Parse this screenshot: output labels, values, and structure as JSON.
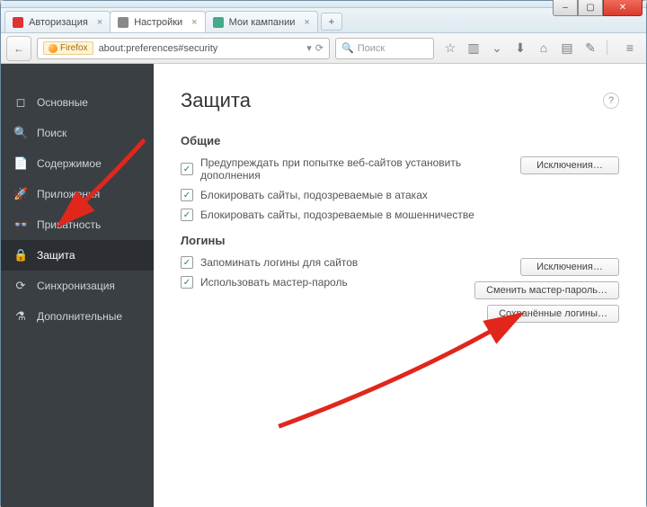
{
  "window": {
    "tabs": [
      {
        "label": "Авторизация"
      },
      {
        "label": "Настройки"
      },
      {
        "label": "Мои кампании"
      }
    ],
    "url_identity": "Firefox",
    "url": "about:preferences#security",
    "search_placeholder": "Поиск",
    "newtab_glyph": "+"
  },
  "sidebar": {
    "items": [
      {
        "icon": "◻",
        "label": "Основные"
      },
      {
        "icon": "🔍",
        "label": "Поиск"
      },
      {
        "icon": "📄",
        "label": "Содержимое"
      },
      {
        "icon": "🚀",
        "label": "Приложения"
      },
      {
        "icon": "👓",
        "label": "Приватность"
      },
      {
        "icon": "🔒",
        "label": "Защита"
      },
      {
        "icon": "⟳",
        "label": "Синхронизация"
      },
      {
        "icon": "⚗",
        "label": "Дополнительные"
      }
    ]
  },
  "page": {
    "title": "Защита",
    "sections": {
      "general": {
        "heading": "Общие",
        "opt1": "Предупреждать при попытке веб-сайтов установить дополнения",
        "opt2": "Блокировать сайты, подозреваемые в атаках",
        "opt3": "Блокировать сайты, подозреваемые в мошенничестве",
        "btn_exceptions": "Исключения…"
      },
      "logins": {
        "heading": "Логины",
        "opt1": "Запоминать логины для сайтов",
        "opt2": "Использовать мастер-пароль",
        "btn_exceptions": "Исключения…",
        "btn_change_master": "Сменить мастер-пароль…",
        "btn_saved": "Сохранённые логины…"
      }
    }
  },
  "glyphs": {
    "back": "←",
    "reload": "⟳",
    "dropdown": "▾",
    "star": "☆",
    "reader": "▥",
    "pocket": "⌄",
    "download": "⬇",
    "home": "⌂",
    "bookmark": "▤",
    "share": "✎",
    "menu": "≡",
    "check": "✓",
    "help": "?",
    "close_x": "×",
    "min": "–",
    "max": "▢",
    "closewin": "✕",
    "search": "🔍"
  }
}
